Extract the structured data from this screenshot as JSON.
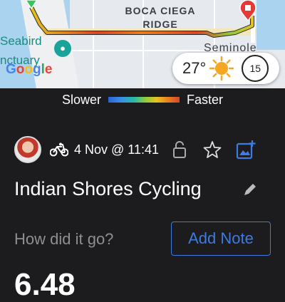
{
  "map": {
    "labels": {
      "boca_ciega_line1": "BOCA CIEGA",
      "boca_ciega_line2": "RIDGE",
      "seabird": "Seabird",
      "sanctuary": "nctuary",
      "seminole": "Seminole",
      "google": "Google"
    },
    "route_colors": [
      "#2f63d6",
      "#28b8a8",
      "#8ecb3c",
      "#e6c21f",
      "#e67e22",
      "#d8452a"
    ],
    "weather": {
      "temperature": "27°",
      "wind_speed": "15"
    }
  },
  "legend": {
    "slower": "Slower",
    "faster": "Faster"
  },
  "activity": {
    "date_time": "4 Nov @ 11:41",
    "title": "Indian Shores Cycling",
    "note_prompt": "How did it go?",
    "add_note_label": "Add Note",
    "distance": "6.48"
  },
  "colors": {
    "accent": "#3d7be0",
    "background": "#1c1c1e",
    "muted_text": "#8e8e93"
  }
}
